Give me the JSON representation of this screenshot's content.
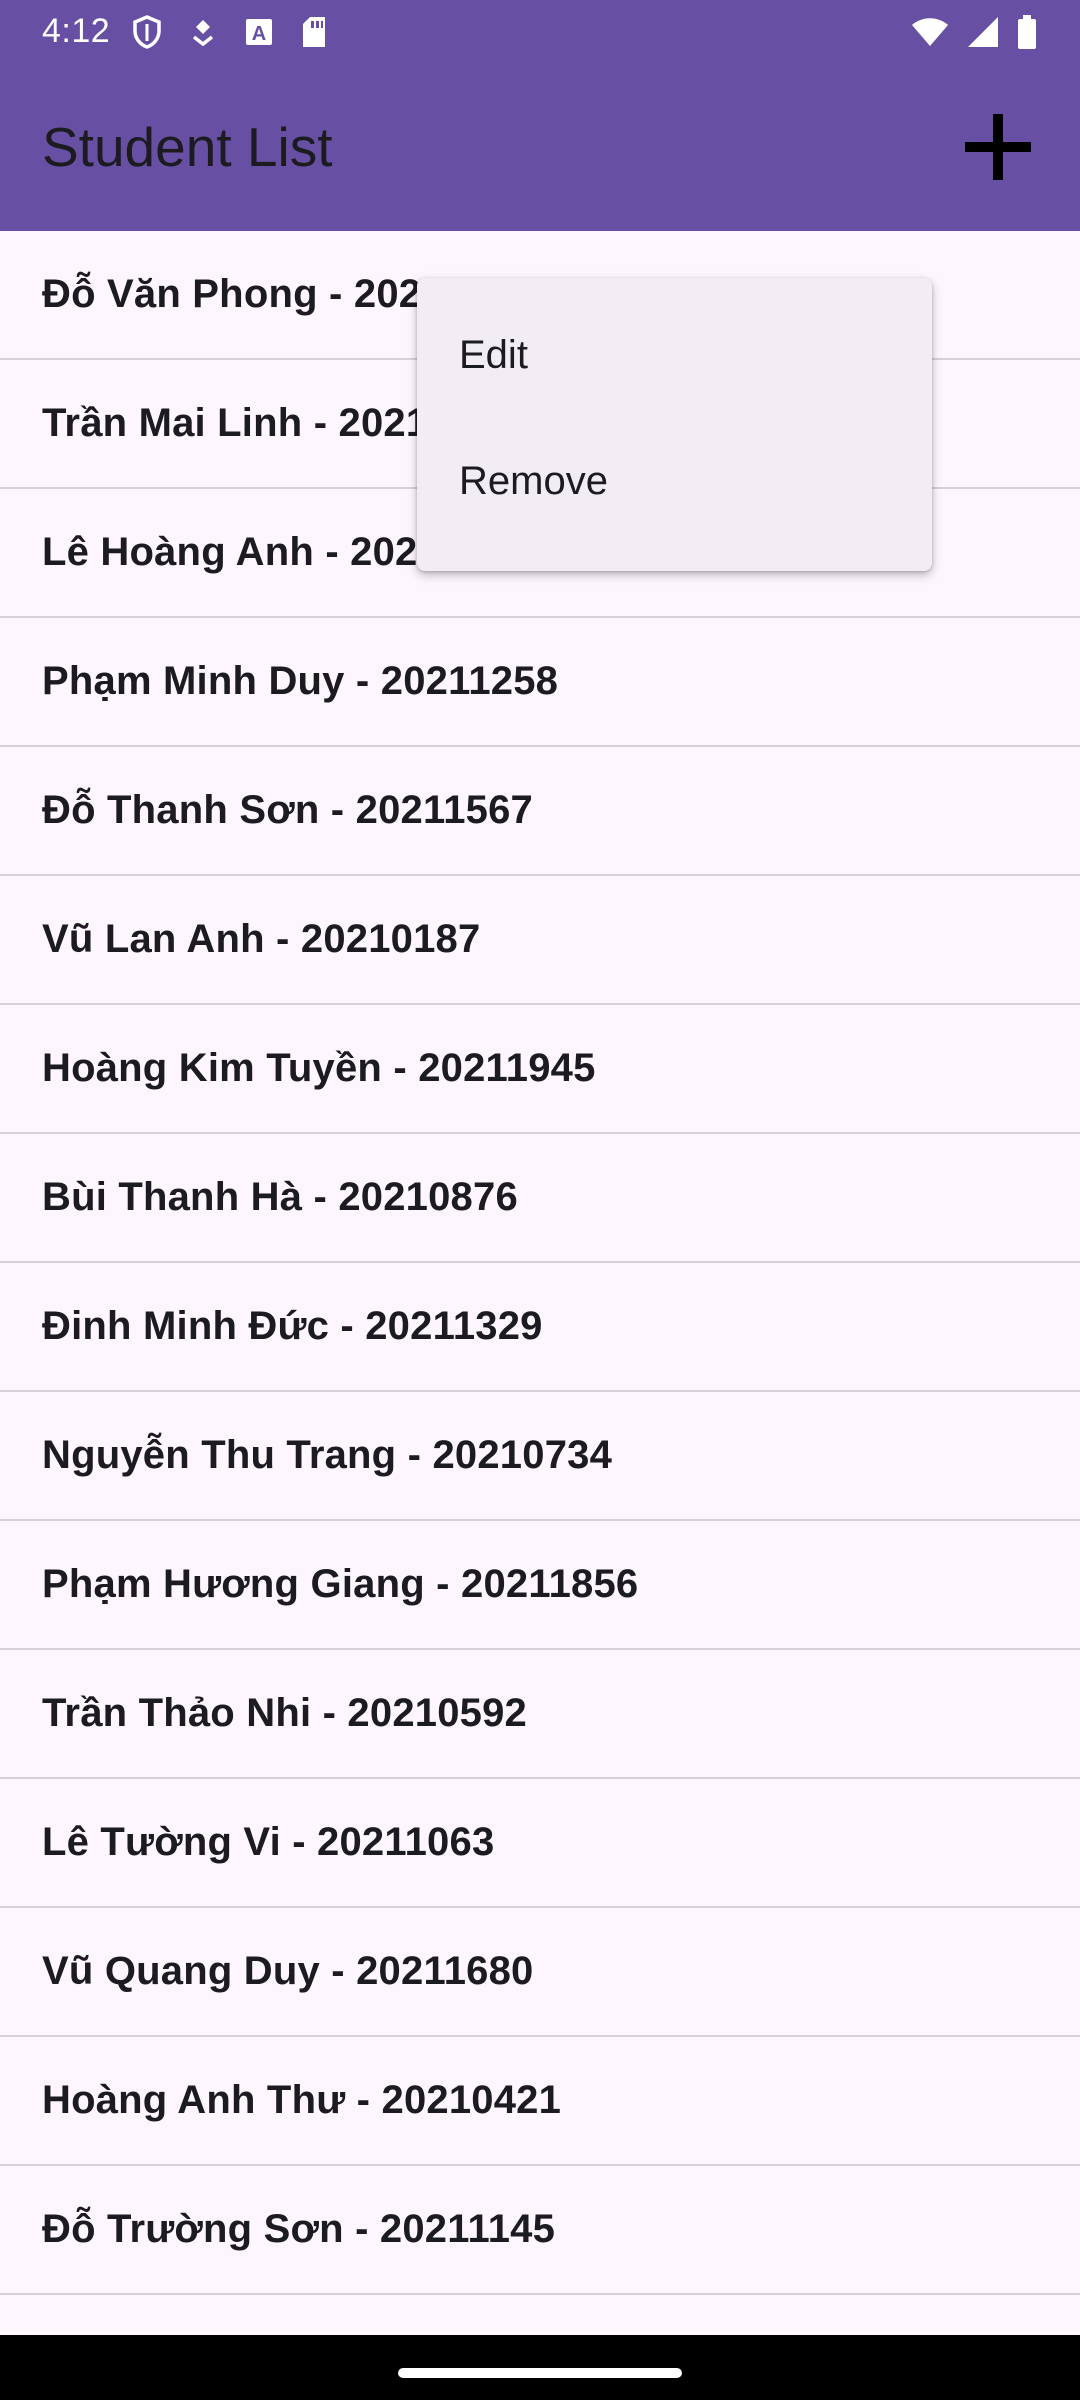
{
  "status_bar": {
    "time": "4:12",
    "left_icons": [
      "shield-icon",
      "drone-icon",
      "text-badge-icon",
      "sd-card-icon"
    ],
    "right_icons": [
      "wifi-icon",
      "cell-signal-icon",
      "battery-icon"
    ]
  },
  "app_bar": {
    "title": "Student List",
    "add_icon": "plus-icon",
    "color": "#6750a4"
  },
  "students": [
    "Đỗ Văn Phong - 202",
    "Trần Mai Linh - 2021",
    "Lê Hoàng Anh - 202",
    "Phạm Minh Duy - 20211258",
    "Đỗ Thanh Sơn - 20211567",
    "Vũ Lan Anh - 20210187",
    "Hoàng Kim Tuyền - 20211945",
    "Bùi Thanh Hà - 20210876",
    "Đinh Minh Đức - 20211329",
    "Nguyễn Thu Trang - 20210734",
    "Phạm Hương Giang - 20211856",
    "Trần Thảo Nhi - 20210592",
    "Lê Tường Vi - 20211063",
    "Vũ Quang Duy - 20211680",
    "Hoàng Anh Thư - 20210421",
    "Đỗ Trường Sơn - 20211145"
  ],
  "context_menu": {
    "items": [
      "Edit",
      "Remove"
    ]
  },
  "colors": {
    "background": "#fdf7fd",
    "menu_background": "#f2edf5",
    "divider": "#d6d1d8"
  }
}
